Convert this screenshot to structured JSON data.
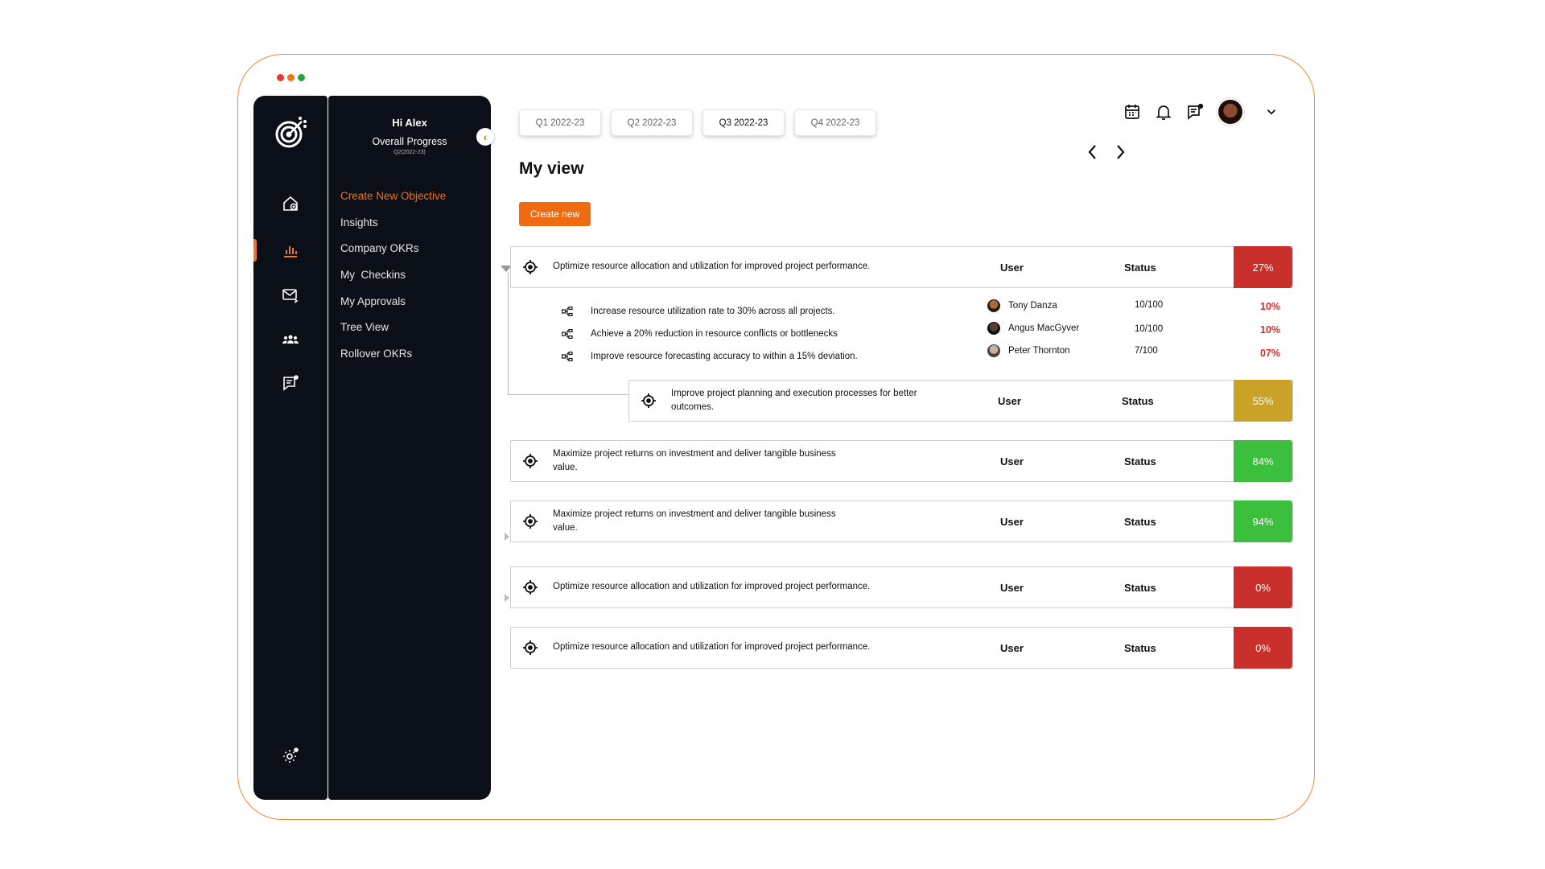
{
  "window": {
    "dot_colors": [
      "#e53935",
      "#f0741c",
      "#2e9e3f"
    ]
  },
  "sidebar": {
    "greeting": "Hi Alex",
    "overall_label": "Overall Progress",
    "period": "Q2(2022-23)",
    "menu": [
      {
        "label": "Create New Objective",
        "active": true
      },
      {
        "label": "Insights"
      },
      {
        "label": "Company OKRs"
      },
      {
        "label": "My  Checkins"
      },
      {
        "label": "My Approvals"
      },
      {
        "label": "Tree View"
      },
      {
        "label": "Rollover OKRs"
      }
    ],
    "rail_icons": [
      "target-logo-icon",
      "home-icon",
      "bar-chart-icon",
      "mail-icon",
      "team-icon",
      "message-icon",
      "settings-icon"
    ]
  },
  "header": {
    "tabs": [
      {
        "label": "Q1 2022-23"
      },
      {
        "label": "Q2 2022-23"
      },
      {
        "label": "Q3 2022-23",
        "active": true
      },
      {
        "label": "Q4 2022-23"
      }
    ],
    "title": "My view",
    "create_label": "Create new",
    "icons": [
      "calendar-icon",
      "bell-icon",
      "chat-icon",
      "avatar",
      "chevron-down-icon"
    ]
  },
  "colors": {
    "accent": "#f06a0f",
    "red": "#c9302c",
    "gold": "#c9a227",
    "green": "#3cbf3c",
    "dark": "#0b0f17"
  },
  "objectives": [
    {
      "text": "Optimize resource allocation and utilization for improved project performance.",
      "user": "User",
      "status": "Status",
      "pct": "27%"
    },
    {
      "text": "Improve project planning and execution processes for better outcomes.",
      "user": "User",
      "status": "Status",
      "pct": "55%"
    },
    {
      "text": "Maximize project returns on investment and deliver tangible business value.",
      "user": "User",
      "status": "Status",
      "pct": "84%"
    },
    {
      "text": "Maximize project returns on investment and deliver tangible business value.",
      "user": "User",
      "status": "Status",
      "pct": "94%"
    },
    {
      "text": "Optimize resource allocation and utilization for improved project performance.",
      "user": "User",
      "status": "Status",
      "pct": "0%"
    },
    {
      "text": "Optimize resource allocation and utilization for improved project performance.",
      "user": "User",
      "status": "Status",
      "pct": "0%"
    }
  ],
  "key_results": [
    {
      "text": "Increase resource utilization rate to 30% across all projects.",
      "owner": "Tony Danza",
      "score": "10/100",
      "pct": "10%"
    },
    {
      "text": "Achieve a 20% reduction in resource conflicts or bottlenecks",
      "owner": "Angus MacGyver",
      "score": "10/100",
      "pct": "10%"
    },
    {
      "text": "Improve resource forecasting accuracy to within a 15% deviation.",
      "owner": "Peter Thornton",
      "score": "7/100",
      "pct": "07%"
    }
  ]
}
